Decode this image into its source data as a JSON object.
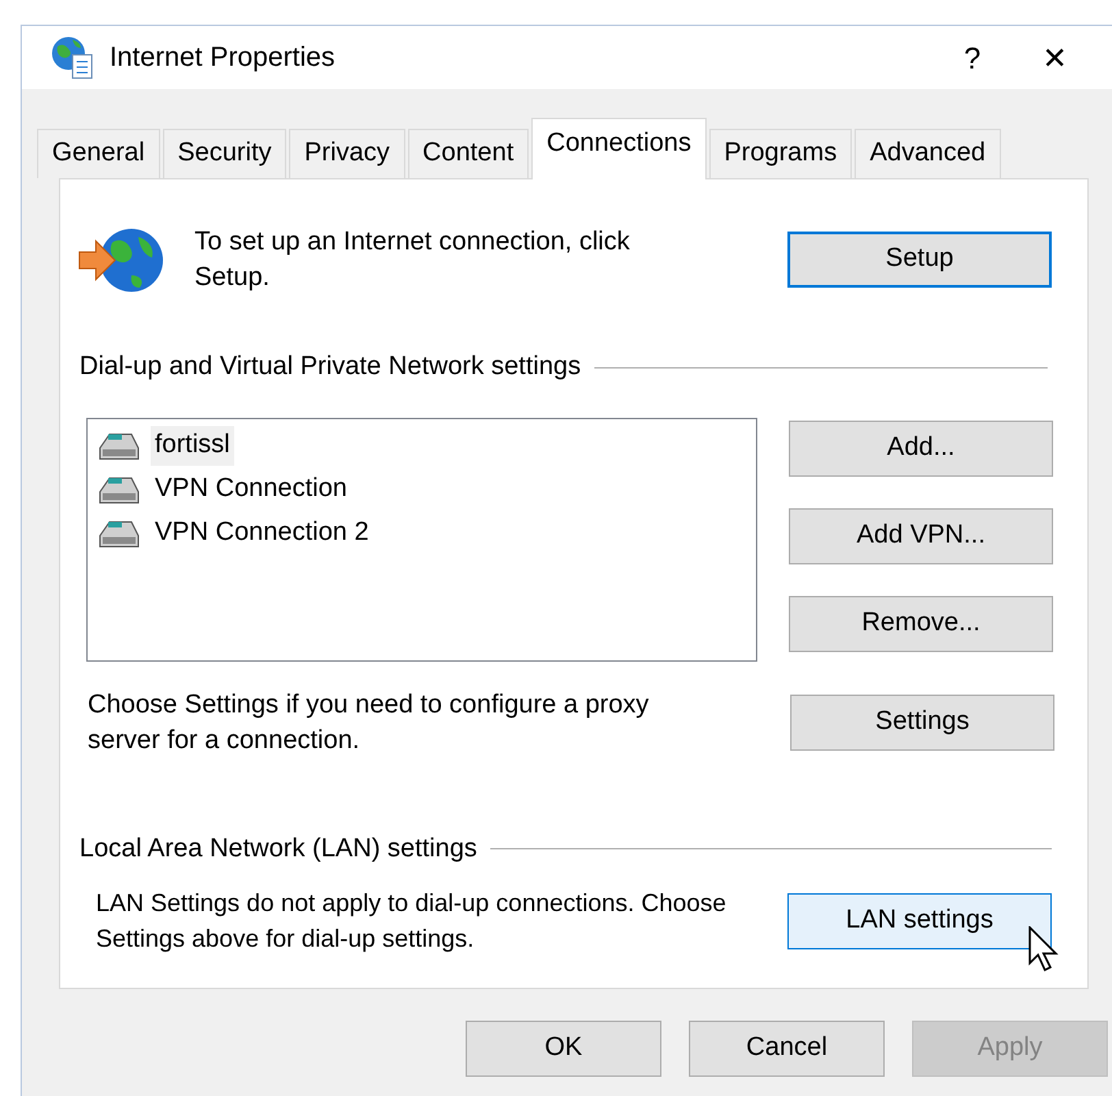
{
  "window": {
    "title": "Internet Properties",
    "help": "?",
    "close": "✕"
  },
  "tabs": [
    {
      "label": "General",
      "selected": false
    },
    {
      "label": "Security",
      "selected": false
    },
    {
      "label": "Privacy",
      "selected": false
    },
    {
      "label": "Content",
      "selected": false
    },
    {
      "label": "Connections",
      "selected": true
    },
    {
      "label": "Programs",
      "selected": false
    },
    {
      "label": "Advanced",
      "selected": false
    }
  ],
  "setup": {
    "text": "To set up an Internet connection, click Setup.",
    "button": {
      "label": "Setup",
      "focused": true,
      "hovered": false
    }
  },
  "dialup": {
    "heading": "Dial-up and Virtual Private Network settings",
    "connections": [
      {
        "name": "fortissl",
        "selected": true
      },
      {
        "name": "VPN Connection",
        "selected": false
      },
      {
        "name": "VPN Connection 2",
        "selected": false
      }
    ],
    "buttons": [
      {
        "label": "Add...",
        "focused": false,
        "hovered": false
      },
      {
        "label": "Add VPN...",
        "focused": false,
        "hovered": false
      },
      {
        "label": "Remove...",
        "focused": false,
        "hovered": false
      }
    ],
    "proxy_text": "Choose Settings if you need to configure a proxy server for a connection.",
    "settings_button": {
      "label": "Settings",
      "focused": false,
      "hovered": false
    }
  },
  "lan": {
    "heading": "Local Area Network (LAN) settings",
    "text": "LAN Settings do not apply to dial-up connections. Choose Settings above for dial-up settings.",
    "button": {
      "label": "LAN settings",
      "focused": false,
      "hovered": true
    }
  },
  "footer_buttons": [
    {
      "label": "OK",
      "disabled": false
    },
    {
      "label": "Cancel",
      "disabled": false
    },
    {
      "label": "Apply",
      "disabled": true
    }
  ]
}
